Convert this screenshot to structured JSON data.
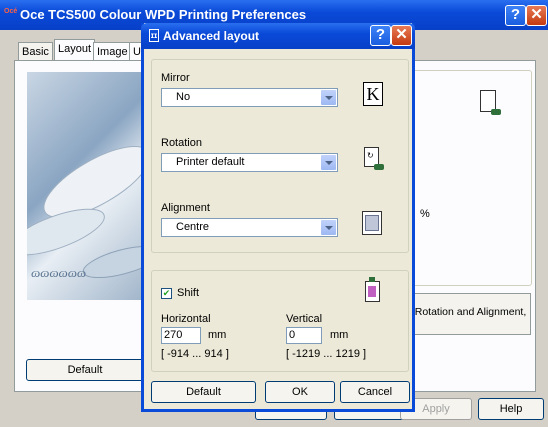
{
  "main_window": {
    "title": "Oce TCS500 Colour WPD Printing Preferences",
    "logo": "Océ",
    "tabs": [
      "Basic",
      "Layout",
      "Image",
      "U"
    ],
    "right_text": "Mirror, Rotation and Alignment,",
    "right_text_visible": "r, Rotation and Alignment,",
    "percent": "%",
    "default_button": "Default",
    "apply_button": "Apply",
    "help_button": "Help"
  },
  "dialog": {
    "title": "Advanced layout",
    "mirror": {
      "label": "Mirror",
      "value": "No",
      "preview": "K"
    },
    "rotation": {
      "label": "Rotation",
      "value": "Printer default"
    },
    "alignment": {
      "label": "Alignment",
      "value": "Centre"
    },
    "shift": {
      "checkbox_label": "Shift",
      "checked": true,
      "horizontal_label": "Horizontal",
      "horizontal_value": "270",
      "horizontal_unit": "mm",
      "horizontal_range": "[ -914 ... 914 ]",
      "vertical_label": "Vertical",
      "vertical_value": "0",
      "vertical_unit": "mm",
      "vertical_range": "[ -1219 ... 1219 ]"
    },
    "default_button": "Default",
    "ok_button": "OK",
    "cancel_button": "Cancel"
  }
}
